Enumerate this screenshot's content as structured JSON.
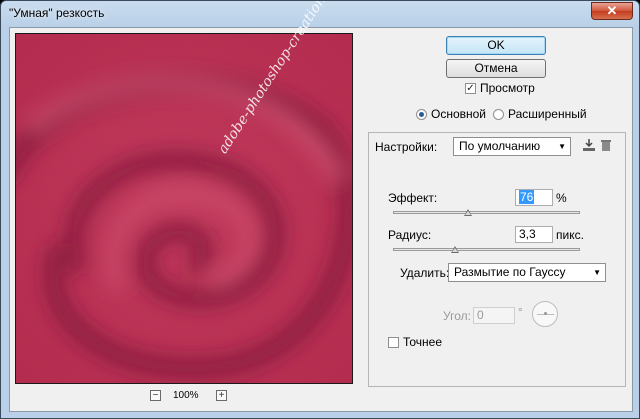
{
  "window": {
    "title": "\"Умная\" резкость",
    "close_glyph": "✕"
  },
  "preview": {
    "zoom_out": "−",
    "zoom_in": "+",
    "zoom_level": "100%",
    "watermark": "adobe-photoshop-creation.blogspot.it"
  },
  "buttons": {
    "ok": "OK",
    "cancel": "Отмена"
  },
  "preview_toggle": {
    "label": "Просмотр",
    "checked": true
  },
  "mode": {
    "basic": "Основной",
    "advanced": "Расширенный",
    "selected": "basic"
  },
  "settings": {
    "label": "Настройки:",
    "value": "По умолчанию",
    "save_icon": "save-preset-icon",
    "delete_icon": "trash-icon"
  },
  "amount": {
    "label": "Эффект:",
    "value": "76",
    "unit": "%",
    "slider_fraction": 0.4
  },
  "radius": {
    "label": "Радиус:",
    "value": "3,3",
    "unit": "пикс.",
    "slider_fraction": 0.33
  },
  "remove": {
    "label": "Удалить:",
    "value": "Размытие по Гауссу"
  },
  "angle": {
    "label": "Угол:",
    "value": "0",
    "unit": "°"
  },
  "more_accurate": {
    "label": "Точнее",
    "checked": false
  },
  "colors": {
    "preview_base": "#b3284a",
    "ok_border": "#3c7fb1",
    "selection": "#3399ff"
  }
}
